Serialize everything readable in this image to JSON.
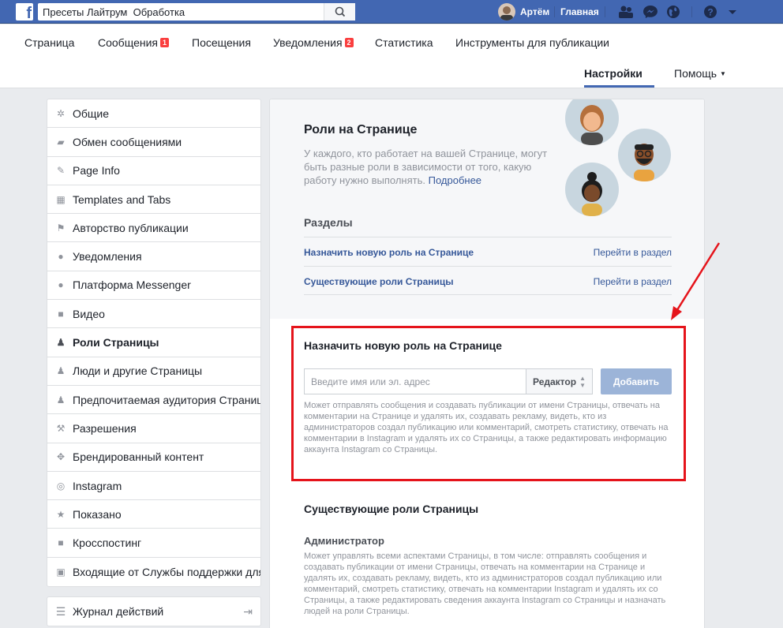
{
  "topbar": {
    "search_value": "Пресеты Лайтрум  Обработка",
    "user_name": "Артём",
    "home_label": "Главная"
  },
  "pagenav": {
    "tabs": [
      {
        "label": "Страница"
      },
      {
        "label": "Сообщения",
        "badge": "1"
      },
      {
        "label": "Посещения"
      },
      {
        "label": "Уведомления",
        "badge": "2"
      },
      {
        "label": "Статистика"
      },
      {
        "label": "Инструменты для публикации"
      }
    ],
    "settings_label": "Настройки",
    "help_label": "Помощь"
  },
  "sidebar": {
    "items": [
      {
        "label": "Общие",
        "icon": "gear-icon"
      },
      {
        "label": "Обмен сообщениями",
        "icon": "messages-icon"
      },
      {
        "label": "Page Info",
        "icon": "pencil-icon"
      },
      {
        "label": "Templates and Tabs",
        "icon": "grid-icon"
      },
      {
        "label": "Авторство публикации",
        "icon": "flag-icon"
      },
      {
        "label": "Уведомления",
        "icon": "globe-icon"
      },
      {
        "label": "Платформа Messenger",
        "icon": "messenger-icon"
      },
      {
        "label": "Видео",
        "icon": "video-icon"
      },
      {
        "label": "Роли Страницы",
        "icon": "person-icon"
      },
      {
        "label": "Люди и другие Страницы",
        "icon": "people-icon"
      },
      {
        "label": "Предпочитаемая аудитория Страницы",
        "icon": "people-icon"
      },
      {
        "label": "Разрешения",
        "icon": "wrench-icon"
      },
      {
        "label": "Брендированный контент",
        "icon": "handshake-icon"
      },
      {
        "label": "Instagram",
        "icon": "instagram-icon"
      },
      {
        "label": "Показано",
        "icon": "star-icon"
      },
      {
        "label": "Кросспостинг",
        "icon": "video-icon"
      },
      {
        "label": "Входящие от Службы поддержки для Страниц",
        "icon": "facebook-icon"
      }
    ],
    "activity_log": "Журнал действий"
  },
  "main": {
    "roles_title": "Роли на Странице",
    "roles_desc": "У каждого, кто работает на вашей Странице, могут быть разные роли в зависимости от того, какую работу нужно выполнять.",
    "more_link": "Подробнее",
    "sections_title": "Разделы",
    "sections": [
      {
        "label": "Назначить новую роль на Странице",
        "action": "Перейти в раздел"
      },
      {
        "label": "Существующие роли Страницы",
        "action": "Перейти в раздел"
      }
    ],
    "assign_title": "Назначить новую роль на Странице",
    "name_placeholder": "Введите имя или эл. адрес",
    "role_selected": "Редактор",
    "add_button": "Добавить",
    "assign_desc": "Может отправлять сообщения и создавать публикации от имени Страницы, отвечать на комментарии на Странице и удалять их, создавать рекламу, видеть, кто из администраторов создал публикацию или комментарий, смотреть статистику, отвечать на комментарии в Instagram и удалять их со Страницы, а также редактировать информацию аккаунта Instagram со Страницы.",
    "existing_title": "Существующие роли Страницы",
    "admin_title": "Администратор",
    "admin_desc": "Может управлять всеми аспектами Страницы, в том числе: отправлять сообщения и создавать публикации от имени Страницы, отвечать на комментарии на Странице и удалять их, создавать рекламу, видеть, кто из администраторов создал публикацию или комментарий, смотреть статистику, отвечать на комментарии Instagram и удалять их со Страницы, а также редактировать сведения аккаунта Instagram со Страницы и назначать людей на роли Страницы."
  },
  "colors": {
    "brand": "#4267b2",
    "link": "#365899",
    "annotation": "#e5141b",
    "add_button_disabled": "#9cb4d8"
  }
}
